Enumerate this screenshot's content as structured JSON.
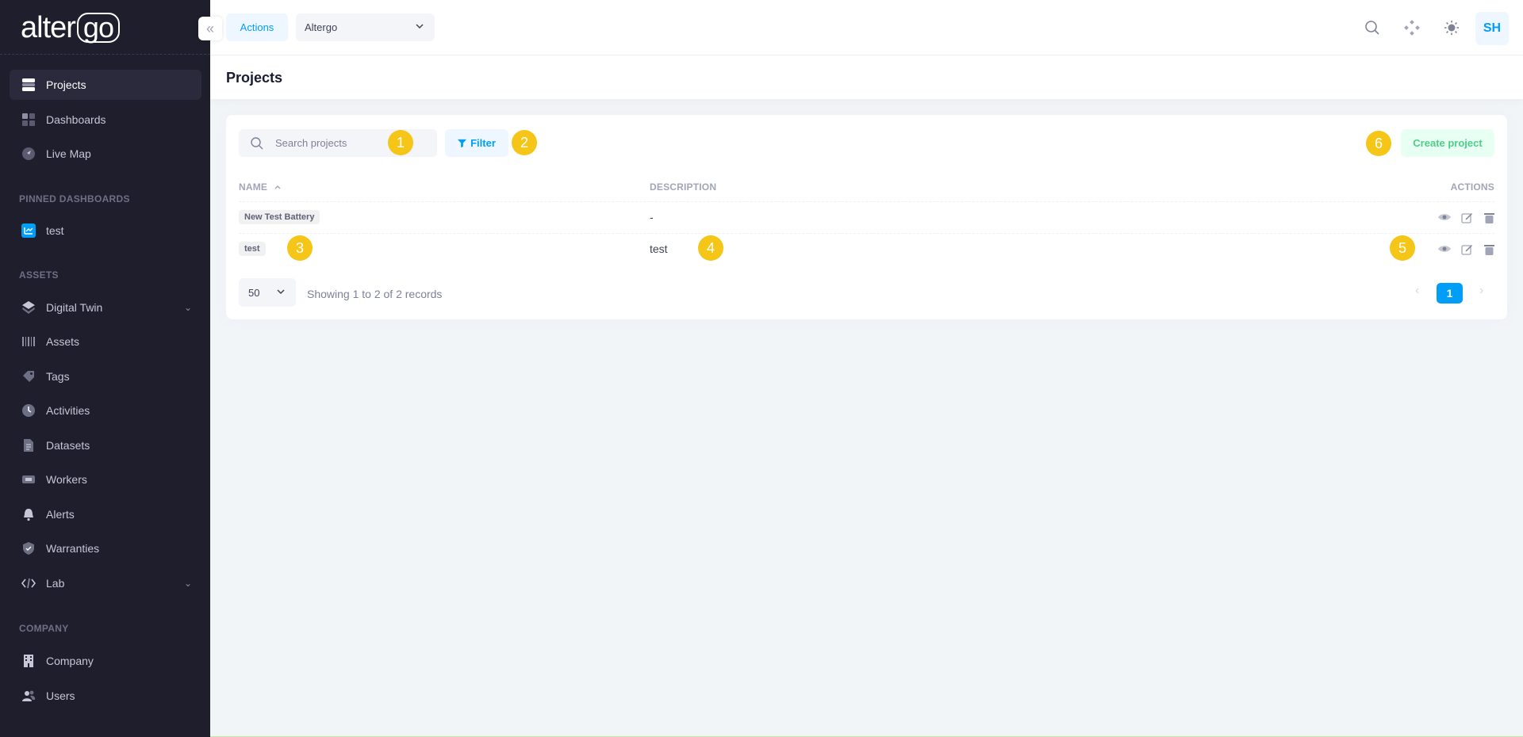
{
  "sidebar": {
    "logo_text": "alter",
    "logo_text_boxed": "go",
    "items": [
      {
        "label": "Projects",
        "icon": "projects-icon"
      },
      {
        "label": "Dashboards",
        "icon": "dashboards-icon"
      },
      {
        "label": "Live Map",
        "icon": "map-icon"
      }
    ],
    "pinned_title": "PINNED DASHBOARDS",
    "pinned": [
      {
        "label": "test",
        "icon": "chart-icon"
      }
    ],
    "assets_title": "ASSETS",
    "assets": [
      {
        "label": "Digital Twin",
        "icon": "layers-icon"
      },
      {
        "label": "Assets",
        "icon": "barcode-icon"
      },
      {
        "label": "Tags",
        "icon": "tag-icon"
      },
      {
        "label": "Activities",
        "icon": "clock-icon"
      },
      {
        "label": "Datasets",
        "icon": "document-icon"
      },
      {
        "label": "Workers",
        "icon": "cpu-icon"
      },
      {
        "label": "Alerts",
        "icon": "bell-icon"
      },
      {
        "label": "Warranties",
        "icon": "shield-icon"
      },
      {
        "label": "Lab",
        "icon": "code-icon"
      }
    ],
    "company_title": "COMPANY",
    "company": [
      {
        "label": "Company",
        "icon": "building-icon"
      },
      {
        "label": "Users",
        "icon": "users-icon"
      }
    ]
  },
  "header": {
    "actions_label": "Actions",
    "org_value": "Altergo",
    "avatar_initials": "SH"
  },
  "page": {
    "title": "Projects"
  },
  "toolbar": {
    "search_placeholder": "Search projects",
    "filter_label": "Filter",
    "create_label": "Create project"
  },
  "table": {
    "headers": {
      "name": "NAME",
      "description": "DESCRIPTION",
      "actions": "ACTIONS"
    },
    "rows": [
      {
        "name": "New Test Battery",
        "description": "-"
      },
      {
        "name": "test",
        "description": "test"
      }
    ]
  },
  "pagination": {
    "page_size": "50",
    "records_text": "Showing 1 to 2 of 2 records",
    "current_page": "1"
  },
  "markers": [
    "1",
    "2",
    "3",
    "4",
    "5",
    "6"
  ],
  "colors": {
    "sidebar_bg": "#1e1e2d",
    "primary": "#009ef7",
    "success": "#50cd89",
    "marker": "#f5c518"
  }
}
